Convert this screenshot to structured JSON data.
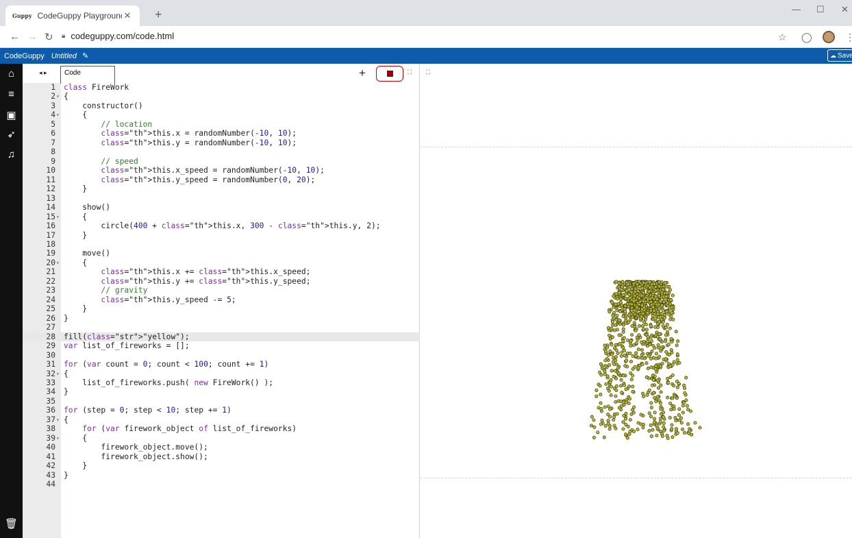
{
  "browser": {
    "tab_title": "CodeGuppy Playground",
    "tab_favicon_text": "Guppy",
    "url": "codeguppy.com/code.html"
  },
  "app": {
    "brand": "CodeGuppy",
    "project_name": "Untitled",
    "save_label": "Save"
  },
  "editor": {
    "tab_label": "Code",
    "active_line": 28,
    "lines": [
      {
        "n": "1",
        "f": "",
        "t": "class FireWork"
      },
      {
        "n": "2",
        "f": "▾",
        "t": "{"
      },
      {
        "n": "3",
        "f": "",
        "t": "    constructor()"
      },
      {
        "n": "4",
        "f": "▾",
        "t": "    {"
      },
      {
        "n": "5",
        "f": "",
        "t": "        // location"
      },
      {
        "n": "6",
        "f": "",
        "t": "        this.x = randomNumber(-10, 10);"
      },
      {
        "n": "7",
        "f": "",
        "t": "        this.y = randomNumber(-10, 10);"
      },
      {
        "n": "8",
        "f": "",
        "t": ""
      },
      {
        "n": "9",
        "f": "",
        "t": "        // speed"
      },
      {
        "n": "10",
        "f": "",
        "t": "        this.x_speed = randomNumber(-10, 10);"
      },
      {
        "n": "11",
        "f": "",
        "t": "        this.y_speed = randomNumber(0, 20);"
      },
      {
        "n": "12",
        "f": "",
        "t": "    }"
      },
      {
        "n": "13",
        "f": "",
        "t": ""
      },
      {
        "n": "14",
        "f": "",
        "t": "    show()"
      },
      {
        "n": "15",
        "f": "▾",
        "t": "    {"
      },
      {
        "n": "16",
        "f": "",
        "t": "        circle(400 + this.x, 300 - this.y, 2);"
      },
      {
        "n": "17",
        "f": "",
        "t": "    }"
      },
      {
        "n": "18",
        "f": "",
        "t": ""
      },
      {
        "n": "19",
        "f": "",
        "t": "    move()"
      },
      {
        "n": "20",
        "f": "▾",
        "t": "    {"
      },
      {
        "n": "21",
        "f": "",
        "t": "        this.x += this.x_speed;"
      },
      {
        "n": "22",
        "f": "",
        "t": "        this.y += this.y_speed;"
      },
      {
        "n": "23",
        "f": "",
        "t": "        // gravity"
      },
      {
        "n": "24",
        "f": "",
        "t": "        this.y_speed -= 5;"
      },
      {
        "n": "25",
        "f": "",
        "t": "    }"
      },
      {
        "n": "26",
        "f": "",
        "t": "}"
      },
      {
        "n": "27",
        "f": "",
        "t": ""
      },
      {
        "n": "28",
        "f": "",
        "t": "fill(\"yellow\");"
      },
      {
        "n": "29",
        "f": "",
        "t": "var list_of_fireworks = [];"
      },
      {
        "n": "30",
        "f": "",
        "t": ""
      },
      {
        "n": "31",
        "f": "",
        "t": "for (var count = 0; count < 100; count += 1)"
      },
      {
        "n": "32",
        "f": "▾",
        "t": "{"
      },
      {
        "n": "33",
        "f": "",
        "t": "    list_of_fireworks.push( new FireWork() );"
      },
      {
        "n": "34",
        "f": "",
        "t": "}"
      },
      {
        "n": "35",
        "f": "",
        "t": ""
      },
      {
        "n": "36",
        "f": "",
        "t": "for (step = 0; step < 10; step += 1)"
      },
      {
        "n": "37",
        "f": "▾",
        "t": "{"
      },
      {
        "n": "38",
        "f": "",
        "t": "    for (var firework_object of list_of_fireworks)"
      },
      {
        "n": "39",
        "f": "▾",
        "t": "    {"
      },
      {
        "n": "40",
        "f": "",
        "t": "        firework_object.move();"
      },
      {
        "n": "41",
        "f": "",
        "t": "        firework_object.show();"
      },
      {
        "n": "42",
        "f": "",
        "t": "    }"
      },
      {
        "n": "43",
        "f": "",
        "t": "}"
      },
      {
        "n": "44",
        "f": "",
        "t": ""
      }
    ]
  },
  "colors": {
    "app_header": "#0d5cab",
    "sidebar": "#111111",
    "particle_fill": "#b5b53a",
    "particle_stroke": "#3a3a10"
  },
  "icons": [
    "home-icon",
    "menu-icon",
    "image-icon",
    "rocket-icon",
    "music-icon",
    "trash-icon",
    "expand-icon",
    "stop-icon",
    "plus-icon",
    "star-icon",
    "lock-icon"
  ]
}
